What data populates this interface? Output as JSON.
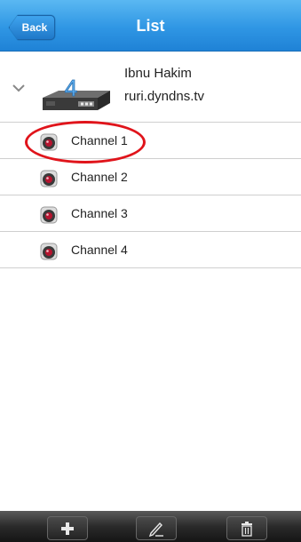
{
  "header": {
    "back_label": "Back",
    "title": "List"
  },
  "device": {
    "name": "Ibnu Hakim",
    "host": "ruri.dyndns.tv",
    "expanded": true,
    "icon": "dvr-device-icon"
  },
  "channels": [
    {
      "label": "Channel 1",
      "icon": "camera-icon",
      "highlighted": true
    },
    {
      "label": "Channel 2",
      "icon": "camera-icon",
      "highlighted": false
    },
    {
      "label": "Channel 3",
      "icon": "camera-icon",
      "highlighted": false
    },
    {
      "label": "Channel 4",
      "icon": "camera-icon",
      "highlighted": false
    }
  ],
  "toolbar": {
    "buttons": [
      {
        "icon": "plus-icon",
        "action": "add"
      },
      {
        "icon": "pencil-icon",
        "action": "edit"
      },
      {
        "icon": "trash-icon",
        "action": "delete"
      }
    ]
  },
  "colors": {
    "header_blue": "#2f96e4",
    "highlight_red": "#e0141b",
    "toolbar_dark": "#2a2a2a"
  }
}
